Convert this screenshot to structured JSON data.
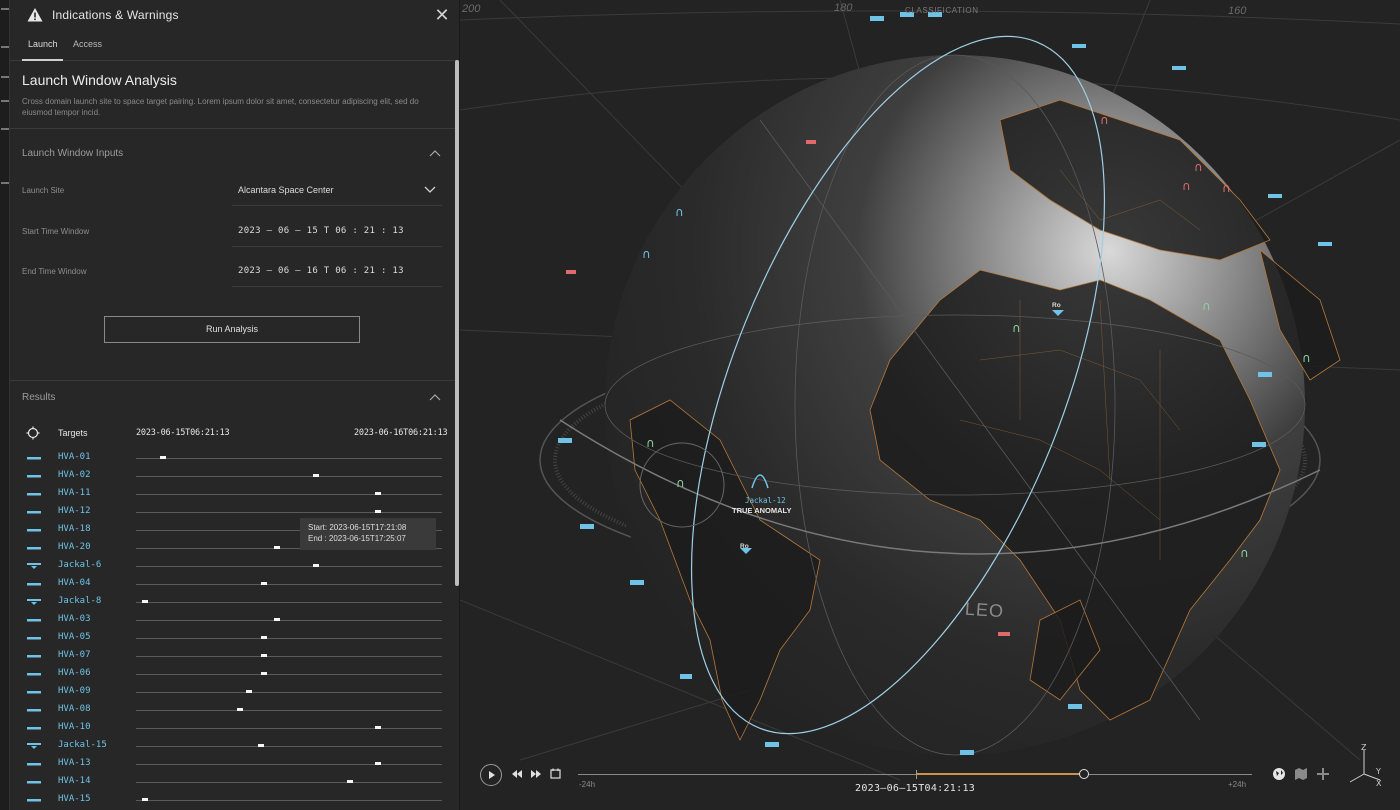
{
  "panel": {
    "title": "Indications & Warnings",
    "close_glyph": "✕",
    "tabs": [
      {
        "label": "Launch",
        "active": true
      },
      {
        "label": "Access",
        "active": false
      }
    ],
    "section_title": "Launch Window Analysis",
    "section_desc": "Cross domain launch site to space target pairing. Lorem ipsum dolor sit amet, consectetur adipiscing elit, sed do eiusmod tempor incid.",
    "inputs": {
      "heading": "Launch Window Inputs",
      "launch_site_label": "Launch Site",
      "launch_site_value": "Alcantara Space Center",
      "start_label": "Start Time Window",
      "start_value": "2023 – 06 – 15 T 06 : 21 : 13",
      "end_label": "End Time Window",
      "end_value": "2023 – 06 – 16 T 06 : 21 : 13"
    },
    "run_button": "Run Analysis",
    "results": {
      "heading": "Results",
      "col_targets": "Targets",
      "col_start": "2023-06-15T06:21:13",
      "col_end": "2023-06-16T06:21:13",
      "rows": [
        {
          "name": "HVA-01",
          "type": "hva",
          "marker": 0.08
        },
        {
          "name": "HVA-02",
          "type": "hva",
          "marker": 0.58
        },
        {
          "name": "HVA-11",
          "type": "hva",
          "marker": 0.78
        },
        {
          "name": "HVA-12",
          "type": "hva",
          "marker": 0.78
        },
        {
          "name": "HVA-18",
          "type": "hva",
          "marker": null
        },
        {
          "name": "HVA-20",
          "type": "hva",
          "marker": 0.45
        },
        {
          "name": "Jackal-6",
          "type": "jackal",
          "marker": 0.58
        },
        {
          "name": "HVA-04",
          "type": "hva",
          "marker": 0.41
        },
        {
          "name": "Jackal-8",
          "type": "jackal",
          "marker": 0.02
        },
        {
          "name": "HVA-03",
          "type": "hva",
          "marker": 0.45
        },
        {
          "name": "HVA-05",
          "type": "hva",
          "marker": 0.41
        },
        {
          "name": "HVA-07",
          "type": "hva",
          "marker": 0.41
        },
        {
          "name": "HVA-06",
          "type": "hva",
          "marker": 0.41
        },
        {
          "name": "HVA-09",
          "type": "hva",
          "marker": 0.36
        },
        {
          "name": "HVA-08",
          "type": "hva",
          "marker": 0.33
        },
        {
          "name": "HVA-10",
          "type": "hva",
          "marker": 0.78
        },
        {
          "name": "Jackal-15",
          "type": "jackal",
          "marker": 0.4
        },
        {
          "name": "HVA-13",
          "type": "hva",
          "marker": 0.78
        },
        {
          "name": "HVA-14",
          "type": "hva",
          "marker": 0.69
        },
        {
          "name": "HVA-15",
          "type": "hva",
          "marker": 0.02
        }
      ],
      "tooltip": {
        "start": "Start: 2023-06-15T17:21:08",
        "end": "End : 2023-06-15T17:25:07"
      }
    }
  },
  "globe": {
    "axis_labels": [
      "200",
      "180",
      "160"
    ],
    "classification": "CLASSIFICATION",
    "orbit_label": "LEO",
    "selected_sat_name": "Jackal-12",
    "selected_sat_sub": "TRUE ANOMALY",
    "ro_labels": [
      "Ro",
      "Ro"
    ]
  },
  "timeline": {
    "left_label": "-24h",
    "right_label": "+24h",
    "current_time": "2023–06–15T04:21:13",
    "progress": 0.75
  },
  "colors": {
    "accent_blue": "#6fc3e6",
    "accent_red": "#e06a6a",
    "accent_green": "#8fd19e",
    "orange_borders": "#b5783a"
  }
}
